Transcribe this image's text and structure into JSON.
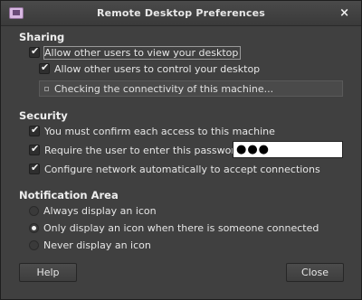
{
  "window": {
    "title": "Remote Desktop Preferences",
    "close_glyph": "×"
  },
  "sharing": {
    "title": "Sharing",
    "allow_view": {
      "label": "Allow other users to view your desktop",
      "checked": true
    },
    "allow_control": {
      "label": "Allow other users to control your desktop",
      "checked": true
    },
    "status": "Checking the connectivity of this machine..."
  },
  "security": {
    "title": "Security",
    "confirm_access": {
      "label": "You must confirm each access to this machine",
      "checked": true
    },
    "require_password": {
      "label": "Require the user to enter this password:",
      "checked": true
    },
    "password_value": "●●●",
    "configure_network": {
      "label": "Configure network automatically to accept connections",
      "checked": true
    }
  },
  "notification": {
    "title": "Notification Area",
    "options": [
      {
        "label": "Always display an icon",
        "selected": false
      },
      {
        "label": "Only display an icon when there is someone connected",
        "selected": true
      },
      {
        "label": "Never display an icon",
        "selected": false
      }
    ]
  },
  "buttons": {
    "help": "Help",
    "close": "Close"
  }
}
